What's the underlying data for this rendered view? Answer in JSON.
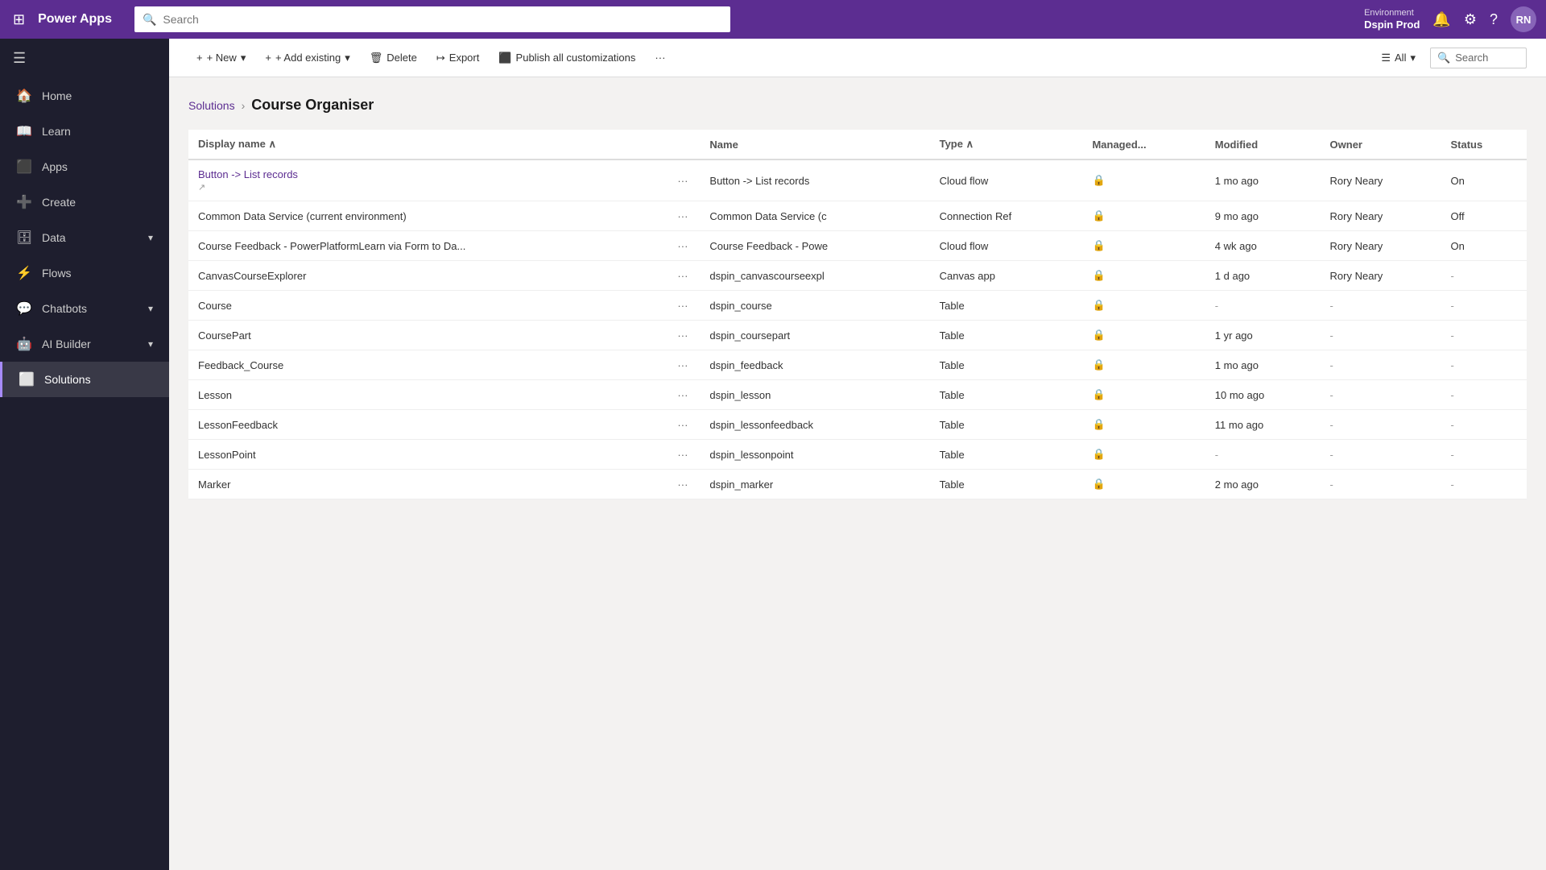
{
  "app": {
    "name": "Power Apps"
  },
  "topbar": {
    "search_placeholder": "Search",
    "env_label": "Environment",
    "env_name": "Dspin Prod"
  },
  "sidebar": {
    "toggle_label": "Collapse",
    "items": [
      {
        "id": "home",
        "label": "Home",
        "icon": "🏠",
        "active": false,
        "expandable": false
      },
      {
        "id": "learn",
        "label": "Learn",
        "icon": "📖",
        "active": false,
        "expandable": false
      },
      {
        "id": "apps",
        "label": "Apps",
        "icon": "⬛",
        "active": false,
        "expandable": false
      },
      {
        "id": "create",
        "label": "Create",
        "icon": "➕",
        "active": false,
        "expandable": false
      },
      {
        "id": "data",
        "label": "Data",
        "icon": "🗄",
        "active": false,
        "expandable": true
      },
      {
        "id": "flows",
        "label": "Flows",
        "icon": "⚡",
        "active": false,
        "expandable": false
      },
      {
        "id": "chatbots",
        "label": "Chatbots",
        "icon": "💬",
        "active": false,
        "expandable": true
      },
      {
        "id": "ai-builder",
        "label": "AI Builder",
        "icon": "🤖",
        "active": false,
        "expandable": true
      },
      {
        "id": "solutions",
        "label": "Solutions",
        "icon": "⬜",
        "active": true,
        "expandable": false
      }
    ]
  },
  "action_bar": {
    "new_label": "+ New",
    "add_existing_label": "+ Add existing",
    "delete_label": "Delete",
    "export_label": "Export",
    "publish_label": "Publish all customizations",
    "more_label": "···",
    "filter_label": "All",
    "search_label": "Search"
  },
  "breadcrumb": {
    "parent": "Solutions",
    "current": "Course Organiser"
  },
  "table": {
    "columns": [
      {
        "id": "display_name",
        "label": "Display name"
      },
      {
        "id": "actions",
        "label": ""
      },
      {
        "id": "name",
        "label": "Name"
      },
      {
        "id": "type",
        "label": "Type"
      },
      {
        "id": "managed",
        "label": "Managed..."
      },
      {
        "id": "modified",
        "label": "Modified"
      },
      {
        "id": "owner",
        "label": "Owner"
      },
      {
        "id": "status",
        "label": "Status"
      }
    ],
    "rows": [
      {
        "display_name": "Button -> List records",
        "display_name_link": true,
        "name": "Button -> List records",
        "type": "Cloud flow",
        "managed": "🔒",
        "modified": "1 mo ago",
        "owner": "Rory Neary",
        "status": "On"
      },
      {
        "display_name": "Common Data Service (current environment)",
        "display_name_link": false,
        "name": "Common Data Service (c",
        "type": "Connection Ref",
        "managed": "🔒",
        "modified": "9 mo ago",
        "owner": "Rory Neary",
        "status": "Off"
      },
      {
        "display_name": "Course Feedback - PowerPlatformLearn via Form to Da...",
        "display_name_link": false,
        "name": "Course Feedback - Powe",
        "type": "Cloud flow",
        "managed": "🔒",
        "modified": "4 wk ago",
        "owner": "Rory Neary",
        "status": "On"
      },
      {
        "display_name": "CanvasCourseExplorer",
        "display_name_link": false,
        "name": "dspin_canvascourseexpl",
        "type": "Canvas app",
        "managed": "🔒",
        "modified": "1 d ago",
        "owner": "Rory Neary",
        "status": "-"
      },
      {
        "display_name": "Course",
        "display_name_link": false,
        "name": "dspin_course",
        "type": "Table",
        "managed": "🔒",
        "modified": "-",
        "owner": "-",
        "status": "-"
      },
      {
        "display_name": "CoursePart",
        "display_name_link": false,
        "name": "dspin_coursepart",
        "type": "Table",
        "managed": "🔒",
        "modified": "1 yr ago",
        "owner": "-",
        "status": "-"
      },
      {
        "display_name": "Feedback_Course",
        "display_name_link": false,
        "name": "dspin_feedback",
        "type": "Table",
        "managed": "🔒",
        "modified": "1 mo ago",
        "owner": "-",
        "status": "-"
      },
      {
        "display_name": "Lesson",
        "display_name_link": false,
        "name": "dspin_lesson",
        "type": "Table",
        "managed": "🔒",
        "modified": "10 mo ago",
        "owner": "-",
        "status": "-"
      },
      {
        "display_name": "LessonFeedback",
        "display_name_link": false,
        "name": "dspin_lessonfeedback",
        "type": "Table",
        "managed": "🔒",
        "modified": "11 mo ago",
        "owner": "-",
        "status": "-"
      },
      {
        "display_name": "LessonPoint",
        "display_name_link": false,
        "name": "dspin_lessonpoint",
        "type": "Table",
        "managed": "🔒",
        "modified": "-",
        "owner": "-",
        "status": "-"
      },
      {
        "display_name": "Marker",
        "display_name_link": false,
        "name": "dspin_marker",
        "type": "Table",
        "managed": "🔒",
        "modified": "2 mo ago",
        "owner": "-",
        "status": "-"
      }
    ]
  }
}
